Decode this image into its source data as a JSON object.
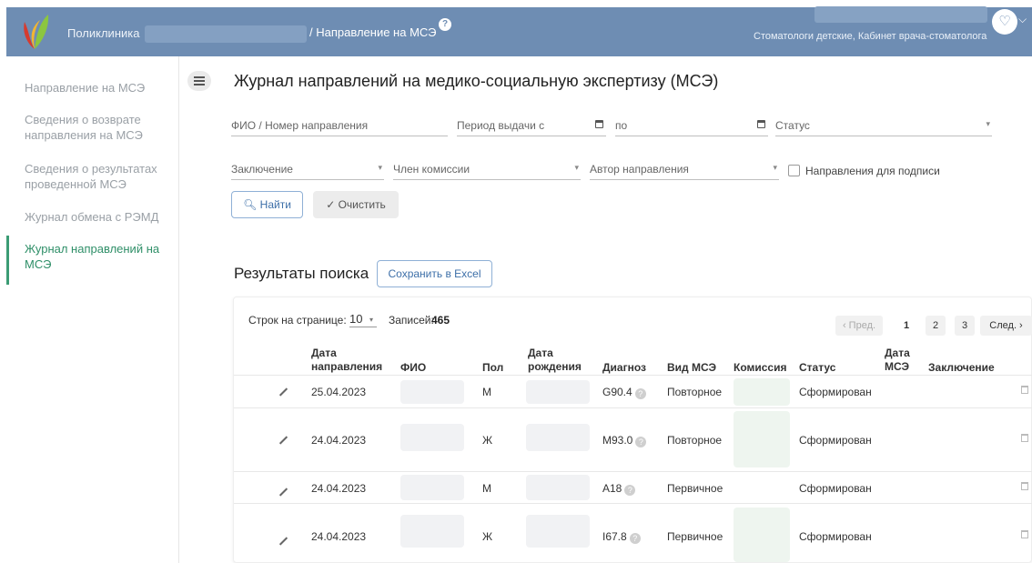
{
  "header": {
    "brand": "Поликлиника",
    "breadcrumb": "/ Направление на МСЭ",
    "help_icon": "question-circle-icon",
    "department": "Стоматологи детские, Кабинет врача-стоматолога",
    "avatar_icon": "stethoscope-icon",
    "avatar_glyph": "♡",
    "chevron": "⌵",
    "colors": {
      "bar": "#6e8db3"
    }
  },
  "sidebar": {
    "items": [
      {
        "label": "Направление на МСЭ",
        "active": false
      },
      {
        "label": "Сведения о возврате направления на МСЭ",
        "active": false
      },
      {
        "label": "Сведения о результатах проведенной МСЭ",
        "active": false
      },
      {
        "label": "Журнал обмена с РЭМД",
        "active": false
      },
      {
        "label": "Журнал направлений на МСЭ",
        "active": true
      }
    ],
    "accent": "#3b9c74"
  },
  "page": {
    "title": "Журнал направлений на медико-социальную экспертизу (МСЭ)"
  },
  "filters": {
    "fio": "ФИО / Номер направления",
    "period_from": "Период выдачи с",
    "period_to": "по",
    "status": "Статус",
    "conclusion": "Заключение",
    "commission_member": "Член комиссии",
    "author": "Автор направления",
    "for_signing": "Направления для подписи",
    "caret": "▾"
  },
  "actions": {
    "find": "🔍︎ Найти",
    "clear": "✓ Очистить",
    "excel": "Сохранить в Excel"
  },
  "results": {
    "title": "Результаты поиска",
    "rows_per_page_label": "Строк на странице:",
    "rows_per_page": "10",
    "records_label": "Записей:",
    "records": "465",
    "pagination": {
      "prev": "‹ Пред.",
      "pages": [
        "1",
        "2",
        "3"
      ],
      "next": "След. ›"
    }
  },
  "table": {
    "headers": {
      "date": "Дата направления",
      "fio": "ФИО",
      "sex": "Пол",
      "birth": "Дата рождения",
      "diag": "Диагноз",
      "type": "Вид МСЭ",
      "comm": "Комиссия",
      "status": "Статус",
      "mse_date": "Дата МСЭ",
      "concl": "Заключение"
    },
    "rows": [
      {
        "date": "25.04.2023",
        "sex": "М",
        "diag": "G90.4",
        "type": "Повторное",
        "status": "Сформирован"
      },
      {
        "date": "24.04.2023",
        "sex": "Ж",
        "diag": "M93.0",
        "type": "Повторное",
        "status": "Сформирован"
      },
      {
        "date": "24.04.2023",
        "sex": "М",
        "diag": "A18",
        "type": "Первичное",
        "status": "Сформирован"
      },
      {
        "date": "24.04.2023",
        "sex": "Ж",
        "diag": "I67.8",
        "type": "Первичное",
        "status": "Сформирован"
      }
    ]
  }
}
